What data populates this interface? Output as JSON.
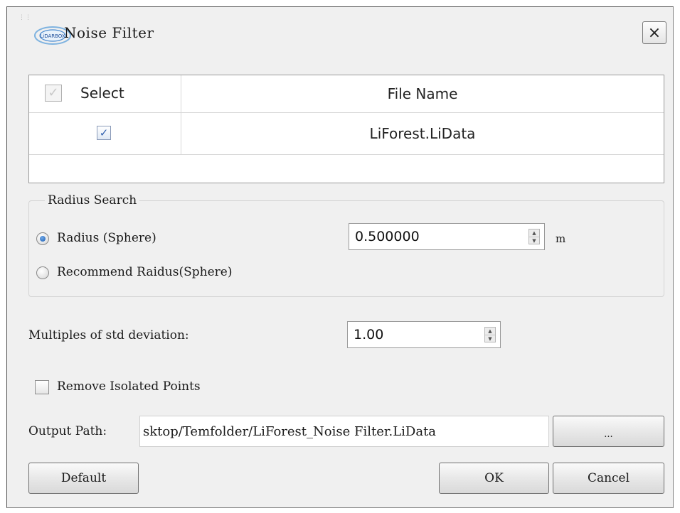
{
  "window": {
    "title": "Noise Filter",
    "close_label": "×",
    "logo_text": "LiDARBOX"
  },
  "file_table": {
    "headers": {
      "select": "Select",
      "file_name": "File Name"
    },
    "rows": [
      {
        "checked": true,
        "file_name": "LiForest.LiData"
      }
    ]
  },
  "radius_search": {
    "title": "Radius Search",
    "options": [
      {
        "label": "Radius (Sphere)",
        "selected": true
      },
      {
        "label": "Recommend Raidus(Sphere)",
        "selected": false
      }
    ],
    "radius_value": "0.500000",
    "radius_unit": "m"
  },
  "std_deviation": {
    "label": "Multiples of std deviation:",
    "value": "1.00"
  },
  "remove_isolated": {
    "label": "Remove Isolated Points",
    "checked": false
  },
  "output": {
    "label": "Output Path:",
    "value": "sktop/Temfolder/LiForest_Noise Filter.LiData",
    "browse_label": "..."
  },
  "buttons": {
    "default": "Default",
    "ok": "OK",
    "cancel": "Cancel"
  },
  "colors": {
    "dialog_bg": "#f0f0f0",
    "check_accent": "#2f5fae",
    "radio_accent": "#1d5fb3"
  },
  "icons": {
    "check": "✓",
    "close": "×",
    "spin_up": "▲",
    "spin_down": "▼"
  }
}
